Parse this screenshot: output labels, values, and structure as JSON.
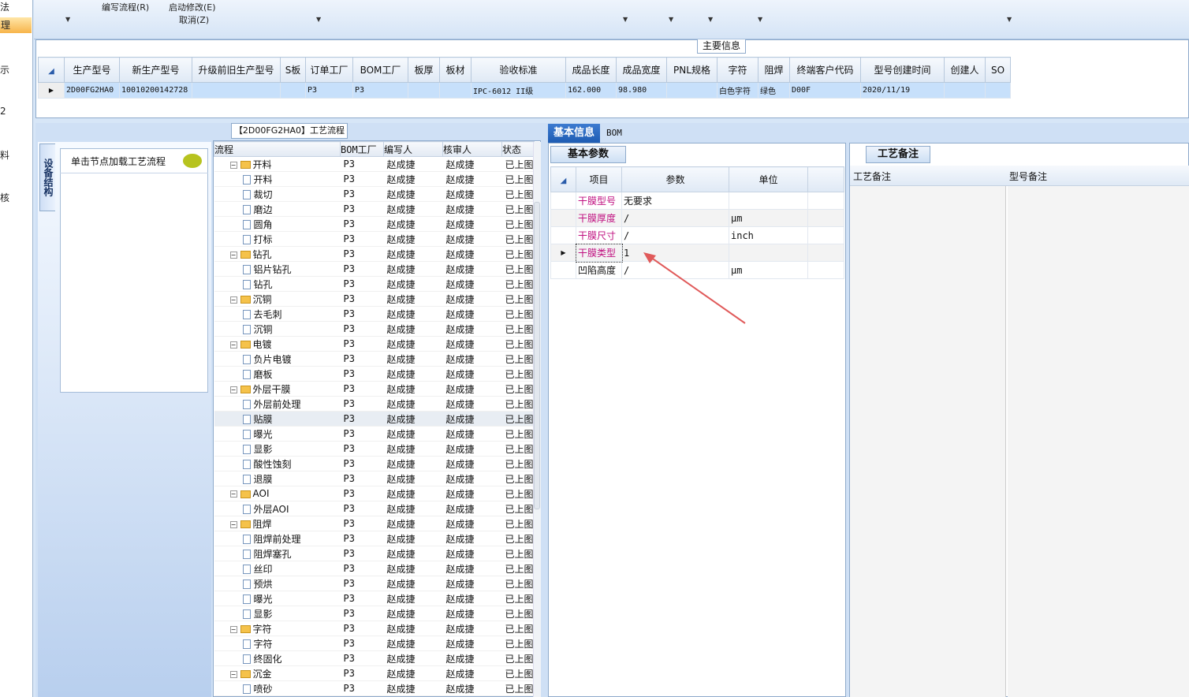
{
  "leftnav": {
    "items": [
      "法",
      "理",
      "示",
      "2",
      "料",
      "核"
    ]
  },
  "ribbon": {
    "write_process": "编写流程(R)",
    "start_modify": "启动修改(E)",
    "cancel": "取消(Z)"
  },
  "top": {
    "tab_label": "主要信息",
    "headers": [
      "生产型号",
      "新生产型号",
      "升级前旧生产型号",
      "S板",
      "订单工厂",
      "BOM工厂",
      "板厚",
      "板材",
      "验收标准",
      "成品长度",
      "成品宽度",
      "PNL规格",
      "字符",
      "阻焊",
      "终端客户代码",
      "型号创建时间",
      "创建人",
      "SO"
    ],
    "row": [
      "2D00FG2HA0",
      "10010200142728",
      "",
      "",
      "P3",
      "P3",
      "",
      "",
      "IPC-6012 II级",
      "162.000",
      "98.980",
      "",
      "白色字符",
      "绿色",
      "D00F",
      "2020/11/19",
      "",
      ""
    ]
  },
  "process": {
    "title": "【2D00FG2HA0】工艺流程",
    "vtab": "设备结构",
    "load_hint": "单击节点加载工艺流程",
    "headers": [
      "流程",
      "BOM工厂",
      "编写人",
      "核审人",
      "状态"
    ],
    "rows": [
      {
        "l": 1,
        "n": "开料"
      },
      {
        "l": 2,
        "n": "开料"
      },
      {
        "l": 2,
        "n": "裁切"
      },
      {
        "l": 2,
        "n": "磨边"
      },
      {
        "l": 2,
        "n": "圆角"
      },
      {
        "l": 2,
        "n": "打标"
      },
      {
        "l": 1,
        "n": "钻孔"
      },
      {
        "l": 2,
        "n": "铝片钻孔"
      },
      {
        "l": 2,
        "n": "钻孔"
      },
      {
        "l": 1,
        "n": "沉铜"
      },
      {
        "l": 2,
        "n": "去毛刺"
      },
      {
        "l": 2,
        "n": "沉铜"
      },
      {
        "l": 1,
        "n": "电镀"
      },
      {
        "l": 2,
        "n": "负片电镀"
      },
      {
        "l": 2,
        "n": "磨板"
      },
      {
        "l": 1,
        "n": "外层干膜"
      },
      {
        "l": 2,
        "n": "外层前处理"
      },
      {
        "l": 2,
        "n": "贴膜"
      },
      {
        "l": 2,
        "n": "曝光"
      },
      {
        "l": 2,
        "n": "显影"
      },
      {
        "l": 2,
        "n": "酸性蚀刻"
      },
      {
        "l": 2,
        "n": "退膜"
      },
      {
        "l": 1,
        "n": "AOI"
      },
      {
        "l": 2,
        "n": "外层AOI"
      },
      {
        "l": 1,
        "n": "阻焊"
      },
      {
        "l": 2,
        "n": "阻焊前处理"
      },
      {
        "l": 2,
        "n": "阻焊塞孔"
      },
      {
        "l": 2,
        "n": "丝印"
      },
      {
        "l": 2,
        "n": "预烘"
      },
      {
        "l": 2,
        "n": "曝光"
      },
      {
        "l": 2,
        "n": "显影"
      },
      {
        "l": 1,
        "n": "字符"
      },
      {
        "l": 2,
        "n": "字符"
      },
      {
        "l": 2,
        "n": "终固化"
      },
      {
        "l": 1,
        "n": "沉金"
      },
      {
        "l": 2,
        "n": "喷砂"
      }
    ],
    "factory": "P3",
    "writer": "赵成捷",
    "reviewer": "赵成捷",
    "status": "已上图"
  },
  "info": {
    "tab_basic": "基本信息",
    "tab_bom": "BOM",
    "basic_params": "基本参数",
    "headers": [
      "项目",
      "参数",
      "单位"
    ],
    "rows": [
      [
        "干膜型号",
        "无要求",
        ""
      ],
      [
        "干膜厚度",
        "/",
        "μm"
      ],
      [
        "干膜尺寸",
        "/",
        "inch"
      ],
      [
        "干膜类型",
        "1",
        ""
      ],
      [
        "凹陷高度",
        "/",
        "μm"
      ]
    ]
  },
  "notes": {
    "tab": "工艺备注",
    "col1": "工艺备注",
    "col2": "型号备注"
  }
}
